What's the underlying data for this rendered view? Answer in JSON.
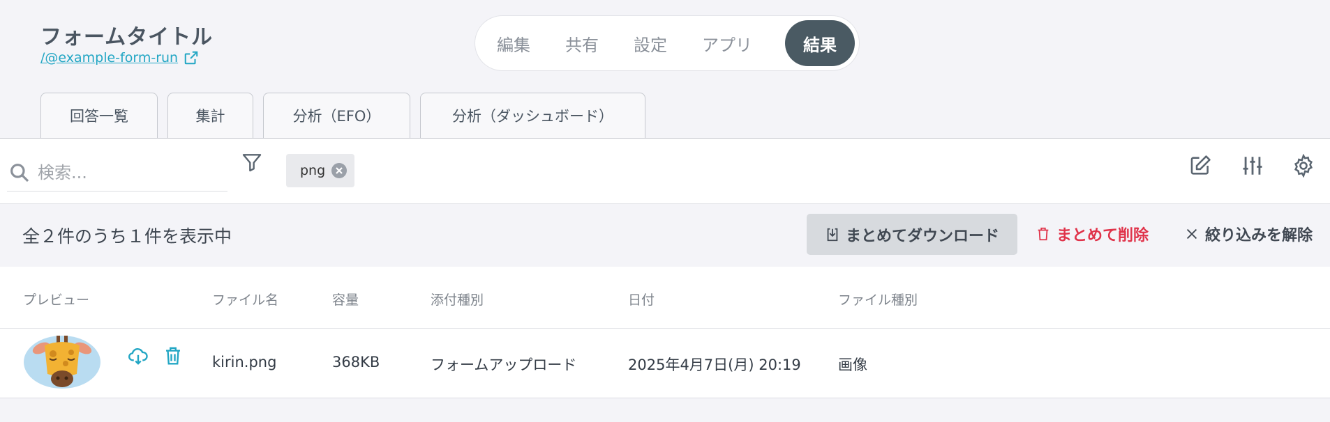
{
  "header": {
    "form_title": "フォームタイトル",
    "form_link": "/@example-form-run"
  },
  "mode_nav": {
    "items": [
      "編集",
      "共有",
      "設定",
      "アプリ"
    ],
    "active": "結果"
  },
  "tabs": [
    "回答一覧",
    "集計",
    "分析（EFO）",
    "分析（ダッシュボード）"
  ],
  "toolbar": {
    "search_placeholder": "検索...",
    "filter_chip": "png"
  },
  "summary": {
    "text": "全２件のうち１件を表示中",
    "download_all": "まとめてダウンロード",
    "delete_all": "まとめて削除",
    "clear_filter": "絞り込みを解除"
  },
  "table": {
    "headers": [
      "プレビュー",
      "ファイル名",
      "容量",
      "添付種別",
      "日付",
      "ファイル種別"
    ],
    "rows": [
      {
        "file_name": "kirin.png",
        "size": "368KB",
        "attachment_type": "フォームアップロード",
        "date": "2025年4月7日(月) 20:19",
        "file_type": "画像"
      }
    ]
  },
  "colors": {
    "accent": "#22a6c4",
    "active_nav": "#4a5a63",
    "danger": "#e0334a"
  }
}
